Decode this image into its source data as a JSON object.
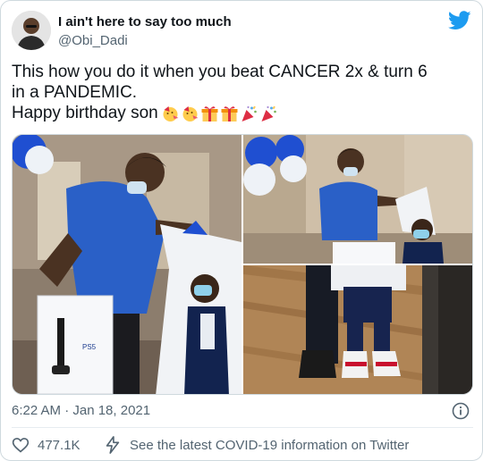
{
  "author": {
    "name": "I ain't here to say too much",
    "handle": "@Obi_Dadi"
  },
  "tweet": {
    "line1": "This how you do it when you beat CANCER 2x & turn 6",
    "line2": "in a PANDEMIC.",
    "line3": "Happy birthday son",
    "emojis": [
      "face-with-party-horn-icon",
      "face-with-party-horn-icon",
      "wrapped-gift-icon",
      "wrapped-gift-icon",
      "party-popper-icon",
      "party-popper-icon"
    ]
  },
  "media": {
    "count": 3,
    "box_label": "PS5"
  },
  "meta": {
    "timestamp": "6:22 AM · Jan 18, 2021"
  },
  "actions": {
    "like_count": "477.1K",
    "covid_info_label": "See the latest COVID-19 information on Twitter"
  },
  "colors": {
    "twitter_blue": "#1d9bf0",
    "secondary_text": "#536471",
    "like_red": "#f91880"
  }
}
